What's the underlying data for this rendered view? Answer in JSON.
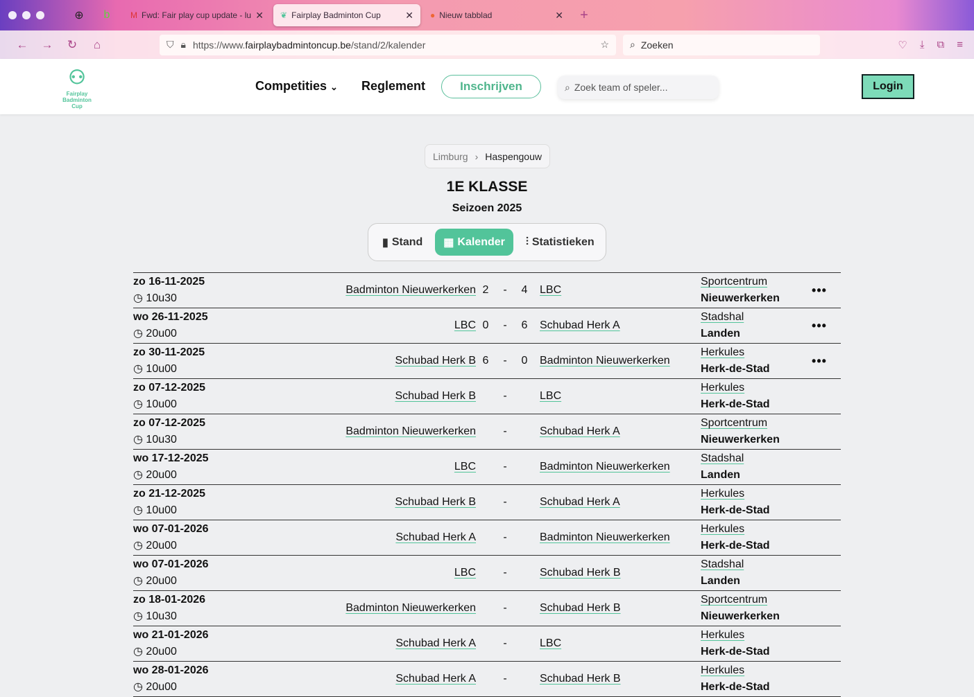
{
  "browser": {
    "tabs": [
      {
        "title": "Fwd: Fair play cup update - luc",
        "active": false
      },
      {
        "title": "Fairplay Badminton Cup",
        "active": true
      },
      {
        "title": "Nieuw tabblad",
        "active": false
      }
    ],
    "url_prefix": "https://www.",
    "url_domain": "fairplaybadmintoncup.be",
    "url_path": "/stand/2/kalender",
    "search_placeholder": "Zoeken"
  },
  "header": {
    "logo_text": "Fairplay Badminton Cup",
    "menu": [
      "Competities",
      "Reglement"
    ],
    "signup": "Inschrijven",
    "search_placeholder": "Zoek team of speler...",
    "login": "Login"
  },
  "breadcrumb": [
    "Limburg",
    "Haspengouw"
  ],
  "title": "1E KLASSE",
  "season": "Seizoen 2025",
  "tabs": [
    "Stand",
    "Kalender",
    "Statistieken"
  ],
  "matches": [
    {
      "date": "zo 16-11-2025",
      "time": "10u30",
      "home": "Badminton Nieuwerkerken",
      "hs": "2",
      "as": "4",
      "away": "LBC",
      "hall": "Sportcentrum",
      "city": "Nieuwerkerken",
      "more": "•••"
    },
    {
      "date": "wo 26-11-2025",
      "time": "20u00",
      "home": "LBC",
      "hs": "0",
      "as": "6",
      "away": "Schubad Herk A",
      "hall": "Stadshal",
      "city": "Landen",
      "more": "•••"
    },
    {
      "date": "zo 30-11-2025",
      "time": "10u00",
      "home": "Schubad Herk B",
      "hs": "6",
      "as": "0",
      "away": "Badminton Nieuwerkerken",
      "hall": "Herkules",
      "city": "Herk-de-Stad",
      "more": "•••"
    },
    {
      "date": "zo 07-12-2025",
      "time": "10u00",
      "home": "Schubad Herk B",
      "hs": "",
      "as": "",
      "away": "LBC",
      "hall": "Herkules",
      "city": "Herk-de-Stad",
      "more": ""
    },
    {
      "date": "zo 07-12-2025",
      "time": "10u30",
      "home": "Badminton Nieuwerkerken",
      "hs": "",
      "as": "",
      "away": "Schubad Herk A",
      "hall": "Sportcentrum",
      "city": "Nieuwerkerken",
      "more": ""
    },
    {
      "date": "wo 17-12-2025",
      "time": "20u00",
      "home": "LBC",
      "hs": "",
      "as": "",
      "away": "Badminton Nieuwerkerken",
      "hall": "Stadshal",
      "city": "Landen",
      "more": ""
    },
    {
      "date": "zo 21-12-2025",
      "time": "10u00",
      "home": "Schubad Herk B",
      "hs": "",
      "as": "",
      "away": "Schubad Herk A",
      "hall": "Herkules",
      "city": "Herk-de-Stad",
      "more": ""
    },
    {
      "date": "wo 07-01-2026",
      "time": "20u00",
      "home": "Schubad Herk A",
      "hs": "",
      "as": "",
      "away": "Badminton Nieuwerkerken",
      "hall": "Herkules",
      "city": "Herk-de-Stad",
      "more": ""
    },
    {
      "date": "wo 07-01-2026",
      "time": "20u00",
      "home": "LBC",
      "hs": "",
      "as": "",
      "away": "Schubad Herk B",
      "hall": "Stadshal",
      "city": "Landen",
      "more": ""
    },
    {
      "date": "zo 18-01-2026",
      "time": "10u30",
      "home": "Badminton Nieuwerkerken",
      "hs": "",
      "as": "",
      "away": "Schubad Herk B",
      "hall": "Sportcentrum",
      "city": "Nieuwerkerken",
      "more": ""
    },
    {
      "date": "wo 21-01-2026",
      "time": "20u00",
      "home": "Schubad Herk A",
      "hs": "",
      "as": "",
      "away": "LBC",
      "hall": "Herkules",
      "city": "Herk-de-Stad",
      "more": ""
    },
    {
      "date": "wo 28-01-2026",
      "time": "20u00",
      "home": "Schubad Herk A",
      "hs": "",
      "as": "",
      "away": "Schubad Herk B",
      "hall": "Herkules",
      "city": "Herk-de-Stad",
      "more": ""
    }
  ],
  "colors": {
    "accent": "#52c49a",
    "login_bg": "#7ddbb9"
  }
}
